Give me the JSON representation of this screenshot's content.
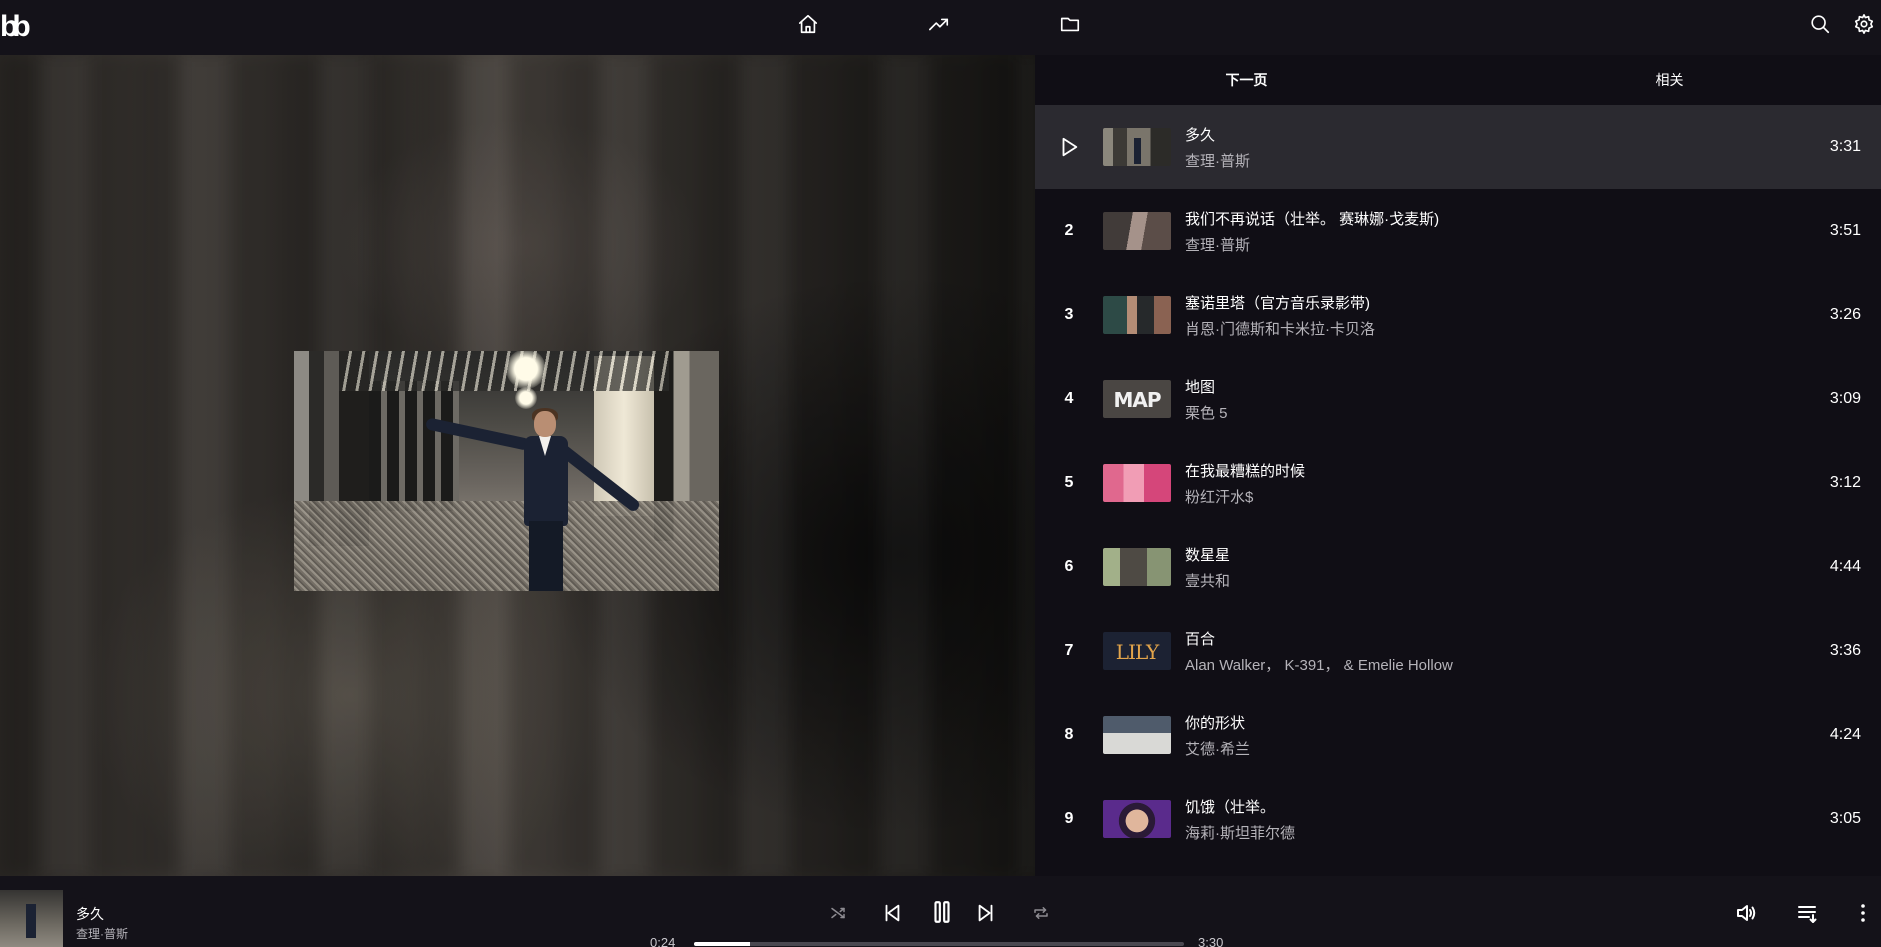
{
  "app": {
    "logo_text": "bb"
  },
  "nav": {
    "items": [
      {
        "icon": "home-icon"
      },
      {
        "icon": "trending-icon"
      },
      {
        "icon": "library-icon"
      }
    ]
  },
  "tabs": [
    {
      "label": "下一页",
      "selected": true
    },
    {
      "label": "相关",
      "selected": false
    }
  ],
  "queue": [
    {
      "index": "",
      "title": "多久",
      "artist": "查理·普斯",
      "duration": "3:31",
      "active": true
    },
    {
      "index": "2",
      "title": "我们不再说话（壮举。 赛琳娜·戈麦斯)",
      "artist": "查理·普斯",
      "duration": "3:51"
    },
    {
      "index": "3",
      "title": "塞诺里塔（官方音乐录影带)",
      "artist": "肖恩·门德斯和卡米拉·卡贝洛",
      "duration": "3:26"
    },
    {
      "index": "4",
      "title": "地图",
      "artist": "栗色 5",
      "duration": "3:09",
      "thumb_text": "MAP"
    },
    {
      "index": "5",
      "title": "在我最糟糕的时候",
      "artist": "粉红汗水$",
      "duration": "3:12"
    },
    {
      "index": "6",
      "title": "数星星",
      "artist": "壹共和",
      "duration": "4:44"
    },
    {
      "index": "7",
      "title": "百合",
      "artist": "Alan Walker， K-391， & Emelie Hollow",
      "duration": "3:36",
      "thumb_text": "LILY"
    },
    {
      "index": "8",
      "title": "你的形状",
      "artist": "艾德·希兰",
      "duration": "4:24"
    },
    {
      "index": "9",
      "title": "饥饿（壮举。",
      "artist": "海莉·斯坦菲尔德",
      "duration": "3:05"
    }
  ],
  "player": {
    "title": "多久",
    "artist": "查理·普斯",
    "current_time": "0:24",
    "total_time": "3:30",
    "progress_fraction": 0.114
  }
}
